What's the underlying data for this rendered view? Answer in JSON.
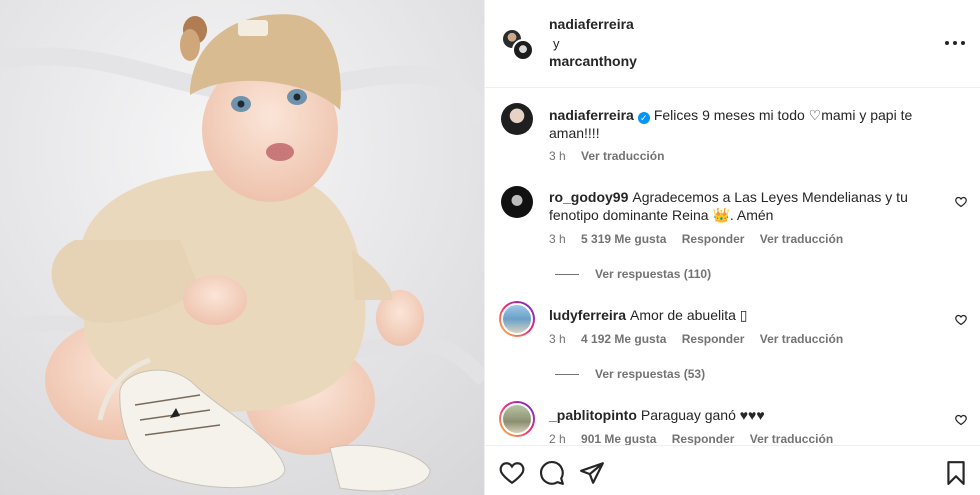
{
  "post": {
    "image_alt": "Bebé con gorro y suéter tejido color crema y zapatillas blancas"
  },
  "header": {
    "author": "nadiaferreira",
    "conjunction": "y",
    "coauthor": "marcanthony"
  },
  "caption": {
    "username": "nadiaferreira",
    "text": "Felices 9 meses mi todo ♡mami y papi te aman!!!!",
    "time": "3 h",
    "translate": "Ver traducción"
  },
  "comments": [
    {
      "username": "ro_godoy99",
      "text": "Agradecemos a Las Leyes Mendelianas y tu fenotipo dominante Reina 👑. Amén",
      "time": "3 h",
      "likes": "5 319 Me gusta",
      "reply": "Responder",
      "translate": "Ver traducción",
      "view_replies": "Ver respuestas (110)"
    },
    {
      "username": "ludyferreira",
      "text": "Amor de abuelita ▯",
      "time": "3 h",
      "likes": "4 192 Me gusta",
      "reply": "Responder",
      "translate": "Ver traducción",
      "view_replies": "Ver respuestas (53)"
    },
    {
      "username": "_pablitopinto",
      "text": "Paraguay ganó ♥♥♥",
      "time": "2 h",
      "likes": "901 Me gusta",
      "reply": "Responder",
      "translate": "Ver traducción"
    }
  ],
  "icons": {
    "like": "heart-icon",
    "comment": "comment-icon",
    "share": "share-icon",
    "save": "bookmark-icon",
    "more": "more-options-icon"
  }
}
